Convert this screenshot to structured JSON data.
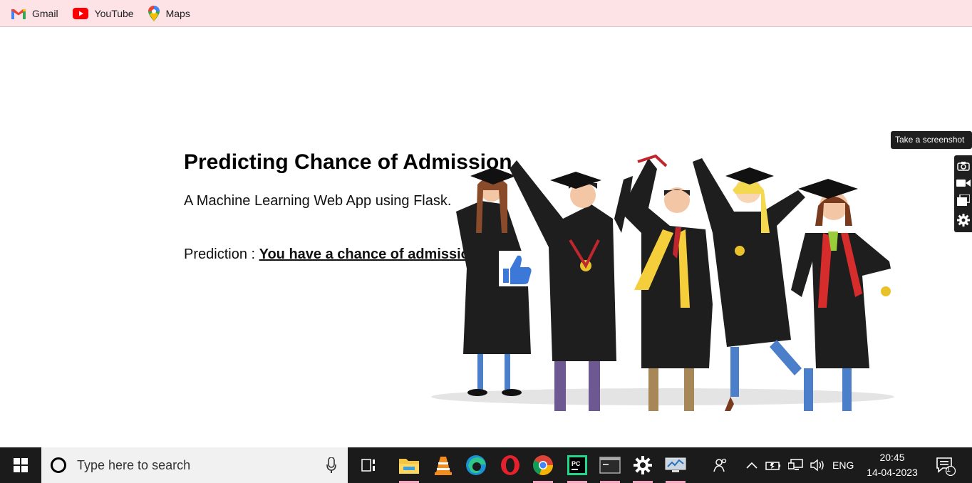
{
  "bookmarks": [
    {
      "label": "Gmail",
      "icon": "gmail-icon"
    },
    {
      "label": "YouTube",
      "icon": "youtube-icon"
    },
    {
      "label": "Maps",
      "icon": "maps-icon"
    }
  ],
  "main": {
    "title": "Predicting Chance of Admission",
    "subtitle": "A Machine Learning Web App using Flask.",
    "prediction_label": "Prediction : ",
    "prediction_value": "You have a chance of admission"
  },
  "screenshot_tool": {
    "tooltip": "Take a screenshot",
    "buttons": [
      "camera-icon",
      "video-icon",
      "windows-icon",
      "settings-icon"
    ]
  },
  "taskbar": {
    "search_placeholder": "Type here to search",
    "apps": [
      "task-view-icon",
      "file-explorer-icon",
      "vlc-icon",
      "edge-icon",
      "opera-icon",
      "chrome-icon",
      "pycharm-icon",
      "terminal-icon",
      "settings-icon",
      "network-monitor-icon"
    ],
    "language": "ENG",
    "time": "20:45",
    "date": "14-04-2023",
    "notification_count": "1"
  },
  "colors": {
    "bookmarks_bg": "#fde2e6",
    "taskbar_bg": "#1b1b1b",
    "app_underline": "#f4a5c0"
  }
}
